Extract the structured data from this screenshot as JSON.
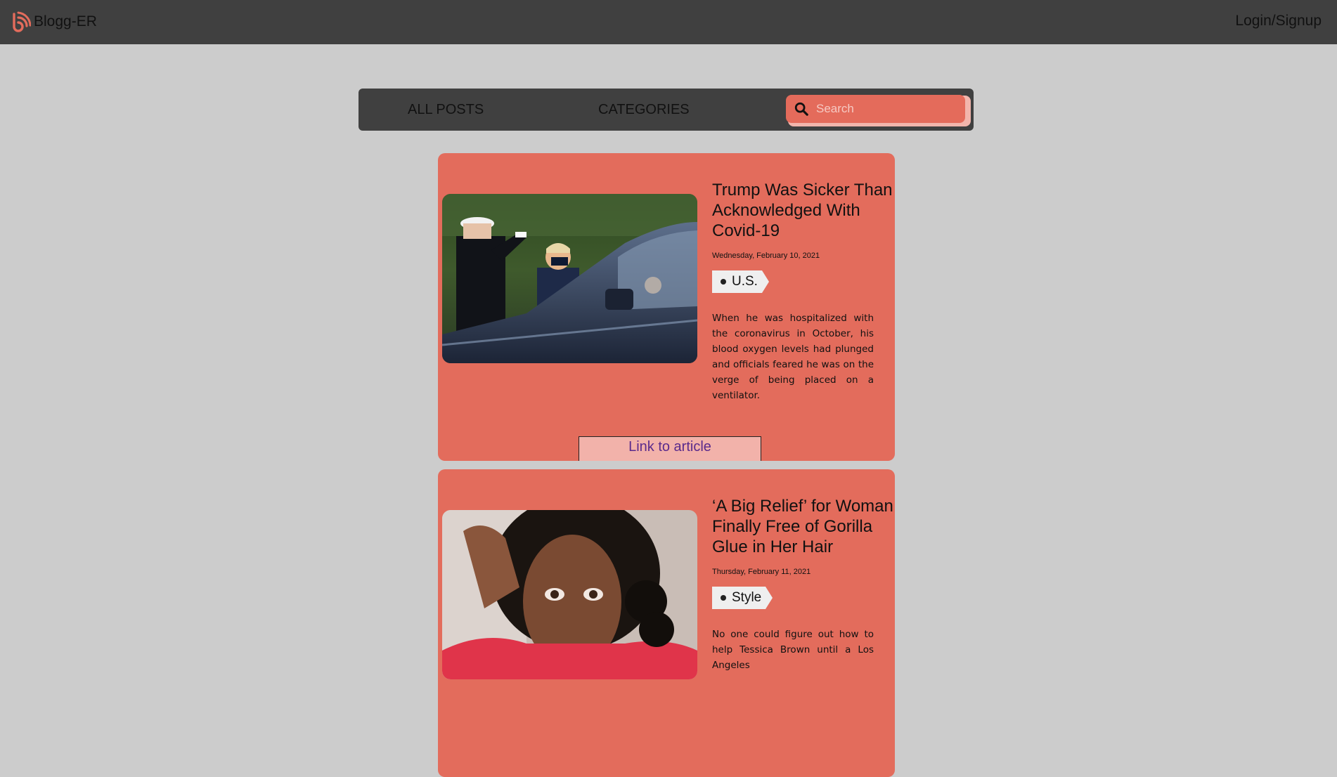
{
  "topbar": {
    "brand_name": "Blogg-ER",
    "login_label": "Login/Signup",
    "brand_color": "#e36c5c"
  },
  "nav": {
    "all_posts": "ALL POSTS",
    "categories": "CATEGORIES",
    "search_placeholder": "Search",
    "search_value": ""
  },
  "posts": [
    {
      "title": "Trump Was Sicker Than Acknowledged With Covid-19",
      "date": "Wednesday, February 10, 2021",
      "category": "U.S.",
      "summary": "When he was hospitalized with the coronavirus in October, his blood oxygen levels had plunged and officials feared he was on the verge of being placed on a ventilator.",
      "link_label": "Link to article",
      "image": "photo-saluting-officer-beside-suv"
    },
    {
      "title": "‘A Big Relief’ for Woman Finally Free of Gorilla Glue in Her Hair",
      "date": "Thursday, February 11, 2021",
      "category": "Style",
      "summary": "No one could figure out how to help Tessica Brown until a Los Angeles",
      "image": "photo-woman-selfie"
    }
  ],
  "colors": {
    "background": "#cccccc",
    "bar": "#404040",
    "card": "#e36c5c",
    "link_text": "#5a2a8c"
  }
}
